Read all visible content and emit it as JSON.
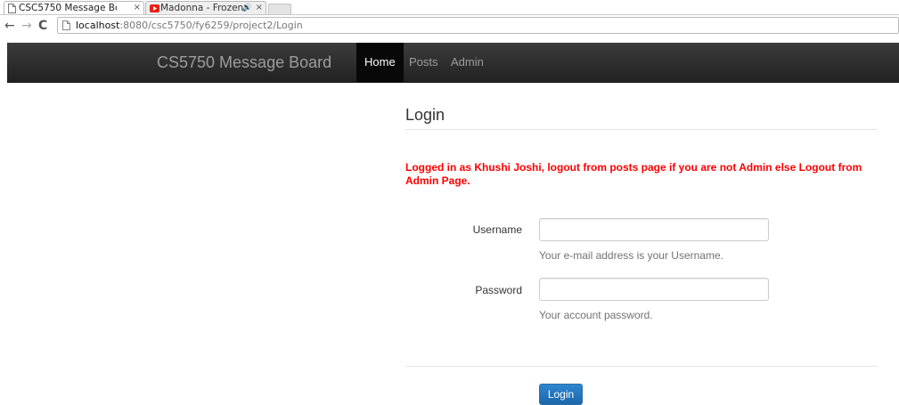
{
  "browser": {
    "tabs": [
      {
        "title": "CSC5750 Message Bo",
        "close": "×"
      },
      {
        "title": "Madonna - Frozen",
        "close": "×",
        "audio": "🔊"
      }
    ],
    "nav": {
      "back": "←",
      "forward": "→",
      "reload": "C"
    },
    "url": {
      "host": "localhost",
      "rest": ":8080/csc5750/fy6259/project2/Login"
    }
  },
  "navbar": {
    "brand": "CS5750 Message Board",
    "links": [
      {
        "label": "Home",
        "active": true
      },
      {
        "label": "Posts",
        "active": false
      },
      {
        "label": "Admin",
        "active": false
      }
    ]
  },
  "main": {
    "heading": "Login",
    "alert": "Logged in as Khushi Joshi, logout from posts page if you are not Admin else Logout from Admin Page.",
    "form": {
      "username": {
        "label": "Username",
        "value": "",
        "help": "Your e-mail address is your Username."
      },
      "password": {
        "label": "Password",
        "value": "",
        "help": "Your account password."
      },
      "submit_label": "Login"
    }
  },
  "colors": {
    "alert": "#ff0000",
    "button": "#2278c0",
    "navbar": "#222222"
  }
}
